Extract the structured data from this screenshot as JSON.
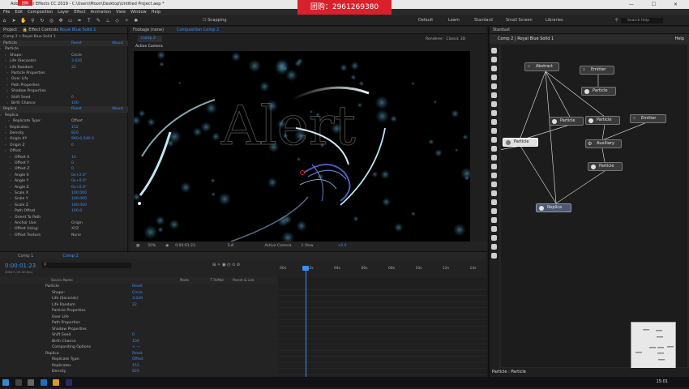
{
  "window": {
    "title": "Adobe After Effects CC 2019 - C:\\Users\\Moon\\Desktop\\Untitled Project.aep *"
  },
  "watermark": {
    "text": "团购：2961269380",
    "small": "团购"
  },
  "menu": [
    "File",
    "Edit",
    "Composition",
    "Layer",
    "Effect",
    "Animation",
    "View",
    "Window",
    "Help"
  ],
  "toolbar": {
    "snapping": "Snapping",
    "workspaces": [
      "Default",
      "Learn",
      "Standard",
      "Small Screen",
      "Libraries"
    ],
    "search_placeholder": "Search Help"
  },
  "effect_controls": {
    "tab_project": "Project",
    "tab_label": "Effect Controls",
    "tab_layer": "Royal Blue Solid 1",
    "breadcrumb": "Comp 2 • Royal Blue Solid 1",
    "rows": [
      {
        "label": "Particle",
        "value": "Reset",
        "extra": "About",
        "indent": 2,
        "group": true
      },
      {
        "label": "Particle",
        "value": "",
        "indent": 4
      },
      {
        "label": "Shape:",
        "value": "Circle",
        "indent": 10,
        "white": true
      },
      {
        "label": "Life (Seconds)",
        "value": "3.020",
        "indent": 10
      },
      {
        "label": "Life Random",
        "value": "22",
        "indent": 10
      },
      {
        "label": "Particle Properties",
        "value": "",
        "indent": 12
      },
      {
        "label": "Over Life",
        "value": "",
        "indent": 12
      },
      {
        "label": "Path Properties",
        "value": "",
        "indent": 12
      },
      {
        "label": "Shadow Properties",
        "value": "",
        "indent": 12
      },
      {
        "label": "Shift Seed",
        "value": "0",
        "indent": 12
      },
      {
        "label": "Birth Chance",
        "value": "100",
        "indent": 12
      },
      {
        "label": "Replica",
        "value": "Reset",
        "extra": "About",
        "indent": 2,
        "group": true
      },
      {
        "label": "Replica",
        "value": "",
        "indent": 4
      },
      {
        "label": "Replicate Type:",
        "value": "Offset",
        "indent": 14,
        "white": true
      },
      {
        "label": "Replicates",
        "value": "152",
        "indent": 10
      },
      {
        "label": "Density",
        "value": "820",
        "indent": 10
      },
      {
        "label": "Origin XY",
        "value": "960.0,540.0",
        "indent": 10
      },
      {
        "label": "Origin Z",
        "value": "0",
        "indent": 10
      },
      {
        "label": "Offset",
        "value": "",
        "indent": 10
      },
      {
        "label": "Offset X",
        "value": "10",
        "indent": 16
      },
      {
        "label": "Offset Y",
        "value": "0",
        "indent": 16
      },
      {
        "label": "Offset Z",
        "value": "0",
        "indent": 16
      },
      {
        "label": "Angle X",
        "value": "0x+2.0°",
        "indent": 16
      },
      {
        "label": "Angle Y",
        "value": "0x+0.0°",
        "indent": 16
      },
      {
        "label": "Angle Z",
        "value": "0x+0.0°",
        "indent": 16
      },
      {
        "label": "Scale X",
        "value": "100.000",
        "indent": 16
      },
      {
        "label": "Scale Y",
        "value": "100.000",
        "indent": 16
      },
      {
        "label": "Scale Z",
        "value": "100.000",
        "indent": 16
      },
      {
        "label": "Path Offset",
        "value": "100.0",
        "indent": 16
      },
      {
        "label": "Orient To Path",
        "value": "",
        "indent": 16
      },
      {
        "label": "Anchor Use:",
        "value": "Origin",
        "indent": 16,
        "white": true
      },
      {
        "label": "Offset Using:",
        "value": "XYZ",
        "indent": 16,
        "white": true
      },
      {
        "label": "Offset Texture",
        "value": "None",
        "indent": 16,
        "white": true
      }
    ]
  },
  "viewer": {
    "tab_footage": "Footage (none)",
    "tab_comp": "Composition Comp 2",
    "subtab": "Comp 2",
    "renderer": "Renderer:",
    "renderer_value": "Classic 3D",
    "label": "Active Camera",
    "canvas_text": "Alert",
    "controls": {
      "zoom": "50%",
      "time": "0:00:01:23",
      "quality": "Full",
      "camera": "Active Camera",
      "view": "1 View",
      "offset": "+0.0"
    }
  },
  "stardust": {
    "title": "Stardust",
    "breadcrumb": "Comp 2 | Royal Blue Solid 1",
    "help": "Help",
    "status": "Particle : Particle",
    "nodes": [
      {
        "label": "Abstract",
        "kind": "grid"
      },
      {
        "label": "Emitter",
        "kind": "grid"
      },
      {
        "label": "Particle",
        "kind": "dot"
      },
      {
        "label": "Particle",
        "kind": "dot"
      },
      {
        "label": "Particle",
        "kind": "dot"
      },
      {
        "label": "Emitter",
        "kind": "grid"
      },
      {
        "label": "Particle",
        "kind": "dot",
        "selected": true
      },
      {
        "label": "Auxiliary",
        "kind": "aux"
      },
      {
        "label": "Particle",
        "kind": "dot"
      },
      {
        "label": "Replica",
        "kind": "dot"
      }
    ]
  },
  "timeline": {
    "tabs": [
      "Comp 1",
      "Comp 2"
    ],
    "timecode": "0:00:01:23",
    "fps": "00047 (25.00 fps)",
    "columns": [
      "Source Name",
      "Mode",
      "T TrkMat",
      "Parent & Link"
    ],
    "ruler": [
      "00s",
      "02s",
      "04s",
      "06s",
      "08s",
      "10s",
      "12s",
      "14s"
    ],
    "rows": [
      {
        "label": "Particle",
        "value": "Reset",
        "indent": 56
      },
      {
        "label": "Shape:",
        "value": "Circle",
        "indent": 64
      },
      {
        "label": "Life (Seconds)",
        "value": "3.020",
        "indent": 64
      },
      {
        "label": "Life Random",
        "value": "22",
        "indent": 64
      },
      {
        "label": "Particle Properties",
        "value": "",
        "indent": 64
      },
      {
        "label": "Over Life",
        "value": "",
        "indent": 64
      },
      {
        "label": "Path Properties",
        "value": "",
        "indent": 64
      },
      {
        "label": "Shadow Properties",
        "value": "",
        "indent": 64
      },
      {
        "label": "Shift Seed",
        "value": "0",
        "indent": 64
      },
      {
        "label": "Birth Chance",
        "value": "100",
        "indent": 64
      },
      {
        "label": "Compositing Options",
        "value": "+ —",
        "indent": 64
      },
      {
        "label": "Replica",
        "value": "Reset",
        "indent": 56
      },
      {
        "label": "Replicate Type:",
        "value": "Offset",
        "indent": 64
      },
      {
        "label": "Replicates",
        "value": "152",
        "indent": 64
      },
      {
        "label": "Density",
        "value": "820",
        "indent": 64
      }
    ]
  },
  "taskbar": {
    "time": "15:01"
  }
}
